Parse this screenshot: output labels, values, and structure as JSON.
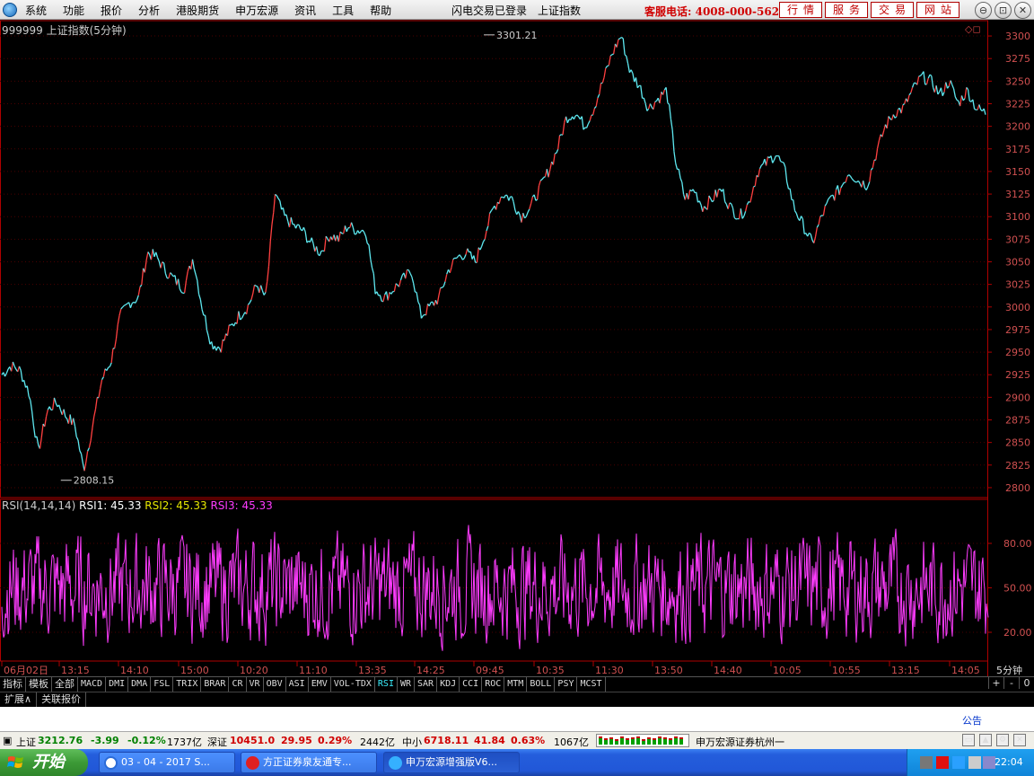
{
  "menu": {
    "items": [
      "系统",
      "功能",
      "报价",
      "分析",
      "港股期货",
      "申万宏源",
      "资讯",
      "工具",
      "帮助"
    ],
    "status": [
      "闪电交易已登录",
      "上证指数"
    ],
    "hotline": "客服电话: 4008-000-562",
    "quick_buttons": [
      "行情",
      "服务",
      "交易",
      "网站"
    ],
    "window_controls": [
      "⊖",
      "⊡",
      "✕"
    ]
  },
  "chart_header": {
    "title": "999999 上证指数(5分钟)",
    "corner_icons": "◇◻"
  },
  "rsi_header": {
    "label": "RSI(14,14,14)",
    "rsi1": "RSI1: 45.33",
    "rsi2": "RSI2: 45.33",
    "rsi3": "RSI3: 45.33"
  },
  "chart_data": [
    {
      "type": "line",
      "name": "上证指数 5分钟",
      "yticks": [
        2800,
        2825,
        2850,
        2875,
        2900,
        2925,
        2950,
        2975,
        3000,
        3025,
        3050,
        3075,
        3100,
        3125,
        3150,
        3175,
        3200,
        3225,
        3250,
        3275,
        3300
      ],
      "ylim": [
        2790,
        3310
      ],
      "annotations": [
        {
          "label": "3301.21",
          "x_index": 0.49,
          "value": 3301.21
        },
        {
          "label": "2808.15",
          "x_index": 0.06,
          "value": 2808.15
        }
      ],
      "points": [
        2925,
        2935,
        2930,
        2905,
        2840,
        2885,
        2895,
        2880,
        2870,
        2820,
        2870,
        2920,
        2940,
        2990,
        3005,
        3010,
        3060,
        3055,
        3040,
        3030,
        3020,
        3055,
        3000,
        2960,
        2955,
        2975,
        2990,
        3000,
        3025,
        3010,
        3125,
        3100,
        3090,
        3085,
        3070,
        3060,
        3080,
        3075,
        3090,
        3085,
        3085,
        3020,
        3010,
        3020,
        3030,
        3040,
        2990,
        3000,
        3010,
        3040,
        3055,
        3060,
        3050,
        3080,
        3110,
        3125,
        3120,
        3100,
        3110,
        3130,
        3150,
        3175,
        3210,
        3215,
        3200,
        3220,
        3250,
        3280,
        3301,
        3260,
        3245,
        3220,
        3230,
        3240,
        3160,
        3120,
        3130,
        3110,
        3120,
        3130,
        3110,
        3100,
        3115,
        3150,
        3160,
        3170,
        3150,
        3110,
        3090,
        3070,
        3100,
        3120,
        3130,
        3150,
        3140,
        3135,
        3170,
        3200,
        3215,
        3220,
        3240,
        3255,
        3250,
        3235,
        3250,
        3225,
        3240,
        3220,
        3215
      ]
    },
    {
      "type": "line",
      "name": "RSI",
      "yticks": [
        20,
        50,
        80
      ],
      "ylim": [
        0,
        100
      ],
      "series": [
        {
          "name": "RSI3",
          "color": "#ff3cff"
        }
      ]
    }
  ],
  "x_axis": {
    "labels": [
      "06月02日",
      "13:15",
      "14:10",
      "15:00",
      "10:20",
      "11:10",
      "13:35",
      "14:25",
      "09:45",
      "10:35",
      "11:30",
      "13:50",
      "14:40",
      "10:05",
      "10:55",
      "13:15",
      "14:05"
    ],
    "period": "5分钟"
  },
  "indicators": {
    "tabs": [
      "指标",
      "模板",
      "全部"
    ],
    "items": [
      "MACD",
      "DMI",
      "DMA",
      "FSL",
      "TRIX",
      "BRAR",
      "CR",
      "VR",
      "OBV",
      "ASI",
      "EMV",
      "VOL-TDX",
      "RSI",
      "WR",
      "SAR",
      "KDJ",
      "CCI",
      "ROC",
      "MTM",
      "BOLL",
      "PSY",
      "MCST"
    ],
    "active": "RSI",
    "right_controls": [
      "+",
      "-",
      "0"
    ]
  },
  "ext_tabs": [
    "扩展∧",
    "关联报价"
  ],
  "notice": "公告",
  "ticker": {
    "sh_label": "上证",
    "sh_value": "3212.76",
    "sh_change": "-3.99",
    "sh_pct": "-0.12%",
    "sh_amount": "1737亿",
    "sz_label": "深证",
    "sz_value": "10451.0",
    "sz_change": "29.95",
    "sz_pct": "0.29%",
    "sz_amount": "2442亿",
    "zx_label": "中小",
    "zx_value": "6718.11",
    "zx_change": "41.84",
    "zx_pct": "0.63%",
    "zx_amount": "1067亿",
    "broker": "申万宏源证券杭州一"
  },
  "taskbar": {
    "start": "开始",
    "tasks": [
      "03 - 04 - 2017 S...",
      "方正证券泉友通专...",
      "申万宏源增强版V6..."
    ],
    "clock": "22:04"
  },
  "colors": {
    "price_line": "#5ee8f0",
    "price_up": "#ff4040",
    "axis_red": "#b00000",
    "rsi_magenta": "#ff3cff"
  }
}
